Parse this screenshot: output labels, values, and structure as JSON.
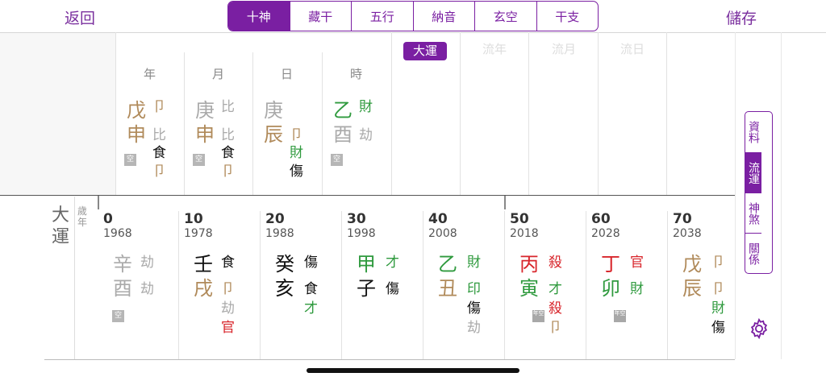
{
  "nav": {
    "back": "返回",
    "save": "儲存",
    "tabs": [
      "十神",
      "藏干",
      "五行",
      "納音",
      "玄空",
      "干支"
    ]
  },
  "pillars": [
    {
      "header": "年",
      "stem": "戊",
      "branch": "申",
      "stem_god": "卩",
      "hidden": [
        "比",
        "食",
        "卩"
      ],
      "kong": "空"
    },
    {
      "header": "月",
      "stem": "庚",
      "branch": "申",
      "stem_god": "比",
      "hidden": [
        "比",
        "食",
        "卩"
      ],
      "kong": "空"
    },
    {
      "header": "日",
      "stem": "庚",
      "branch": "辰",
      "stem_god": "",
      "hidden": [
        "卩",
        "財",
        "傷"
      ],
      "kong": ""
    },
    {
      "header": "時",
      "stem": "乙",
      "branch": "酉",
      "stem_god": "財",
      "hidden": [
        "劫"
      ],
      "kong": "空"
    }
  ],
  "yun_headers": [
    "大運",
    "流年",
    "流月",
    "流日"
  ],
  "side_tabs": [
    "資料",
    "流運",
    "神煞",
    "關係"
  ],
  "dayun_label": "大運",
  "age_year_label": "歲年",
  "dayun": [
    {
      "age": "0",
      "year": "1968",
      "stem": "辛",
      "branch": "酉",
      "stem_god": "劫",
      "hidden": [
        "劫"
      ],
      "tag": "空"
    },
    {
      "age": "10",
      "year": "1978",
      "stem": "壬",
      "branch": "戌",
      "stem_god": "食",
      "hidden": [
        "卩",
        "劫",
        "官"
      ],
      "tag": ""
    },
    {
      "age": "20",
      "year": "1988",
      "stem": "癸",
      "branch": "亥",
      "stem_god": "傷",
      "hidden": [
        "食",
        "才"
      ],
      "tag": ""
    },
    {
      "age": "30",
      "year": "1998",
      "stem": "甲",
      "branch": "子",
      "stem_god": "才",
      "hidden": [
        "傷"
      ],
      "tag": ""
    },
    {
      "age": "40",
      "year": "2008",
      "stem": "乙",
      "branch": "丑",
      "stem_god": "財",
      "hidden": [
        "印",
        "傷",
        "劫"
      ],
      "tag": ""
    },
    {
      "age": "50",
      "year": "2018",
      "stem": "丙",
      "branch": "寅",
      "stem_god": "殺",
      "hidden": [
        "才",
        "殺",
        "卩"
      ],
      "tag": "年空"
    },
    {
      "age": "60",
      "year": "2028",
      "stem": "丁",
      "branch": "卯",
      "stem_god": "官",
      "hidden": [
        "財"
      ],
      "tag": "年空"
    },
    {
      "age": "70",
      "year": "2038",
      "stem": "戊",
      "branch": "辰",
      "stem_god": "卩",
      "hidden": [
        "卩",
        "財",
        "傷"
      ],
      "tag": ""
    }
  ],
  "colors": {
    "accent": "#7a1fa2",
    "earth": "#b08a5a",
    "wood": "#2f9a3e",
    "fire": "#d8262c",
    "metal": "#aaaaaa",
    "water": "#111111"
  }
}
